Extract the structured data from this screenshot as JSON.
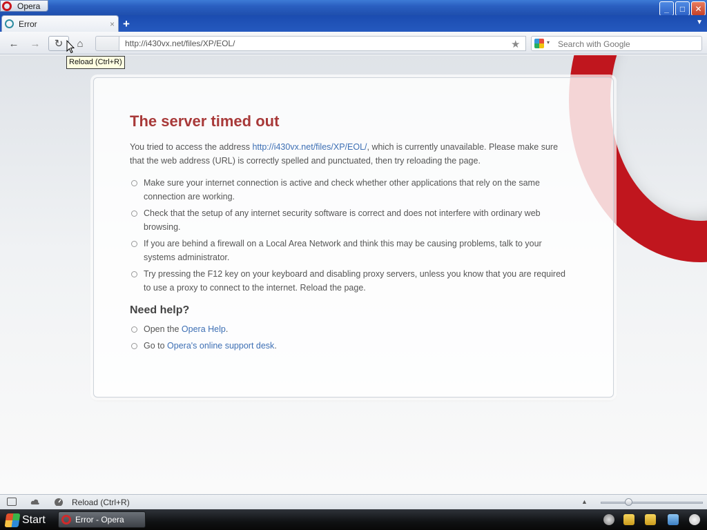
{
  "window": {
    "menu_label": "Opera",
    "minimize": "_",
    "maximize": "□",
    "close": "✕"
  },
  "tabs": [
    {
      "label": "Error",
      "close": "×"
    }
  ],
  "tabbar": {
    "new_tab": "+",
    "menu": "▼"
  },
  "toolbar": {
    "back_icon": "←",
    "forward_icon": "→",
    "reload_icon": "↻",
    "home_icon": "⌂",
    "address": "http://i430vx.net/files/XP/EOL/",
    "bookmark_icon": "★",
    "search_placeholder": "Search with Google",
    "search_arrow": "▾"
  },
  "tooltip": "Reload (Ctrl+R)",
  "page": {
    "title": "The server timed out",
    "intro_prefix": "You tried to access the address ",
    "intro_link": "http://i430vx.net/files/XP/EOL/",
    "intro_suffix": ", which is currently unavailable. Please make sure that the web address (URL) is correctly spelled and punctuated, then try reloading the page.",
    "tips": [
      "Make sure your internet connection is active and check whether other applications that rely on the same connection are working.",
      "Check that the setup of any internet security software is correct and does not interfere with ordinary web browsing.",
      "If you are behind a firewall on a Local Area Network and think this may be causing problems, talk to your systems administrator.",
      "Try pressing the F12 key on your keyboard and disabling proxy servers, unless you know that you are required to use a proxy to connect to the internet. Reload the page."
    ],
    "help_title": "Need help?",
    "help_1_prefix": "Open the ",
    "help_1_link": "Opera Help",
    "help_1_suffix": ".",
    "help_2_prefix": "Go to ",
    "help_2_link": "Opera's online support desk",
    "help_2_suffix": "."
  },
  "statusbar": {
    "text": "Reload (Ctrl+R)",
    "up_icon": "▲"
  },
  "taskbar": {
    "start_label": "Start",
    "task_label": "Error - Opera"
  },
  "colors": {
    "title_red": "#a83939",
    "link_blue": "#3d6fb4",
    "opera_red": "#c0161e"
  }
}
